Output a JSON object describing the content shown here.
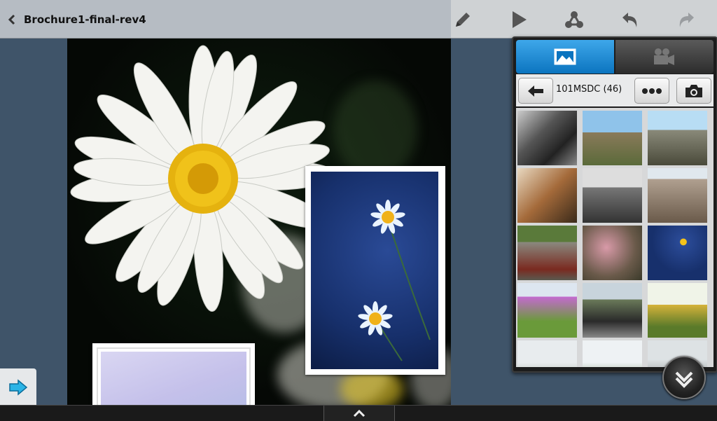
{
  "document": {
    "title": "Brochure1-final-rev4"
  },
  "toolbar": {
    "icons": [
      "pencil-icon",
      "play-icon",
      "share-icon",
      "undo-icon",
      "redo-icon"
    ]
  },
  "media_panel": {
    "tabs": [
      {
        "name": "photos",
        "icon": "image-icon",
        "active": true
      },
      {
        "name": "videos",
        "icon": "video-camera-icon",
        "active": false
      }
    ],
    "folder_label": "101MSDC (46)",
    "accent_color": "#1b88d2",
    "thumbnails": [
      {
        "name": "thumb-black-white-ruins"
      },
      {
        "name": "thumb-rock-mountain"
      },
      {
        "name": "thumb-mountain-peaks"
      },
      {
        "name": "thumb-kitchen-stove"
      },
      {
        "name": "thumb-old-building-roof"
      },
      {
        "name": "thumb-brick-house"
      },
      {
        "name": "thumb-red-door-building"
      },
      {
        "name": "thumb-bokeh-flower"
      },
      {
        "name": "thumb-blue-daisies"
      },
      {
        "name": "thumb-pink-flowers"
      },
      {
        "name": "thumb-car-street"
      },
      {
        "name": "thumb-person-field"
      },
      {
        "name": "thumb-house"
      },
      {
        "name": "thumb-tree"
      },
      {
        "name": "thumb-garden-trees"
      }
    ]
  }
}
